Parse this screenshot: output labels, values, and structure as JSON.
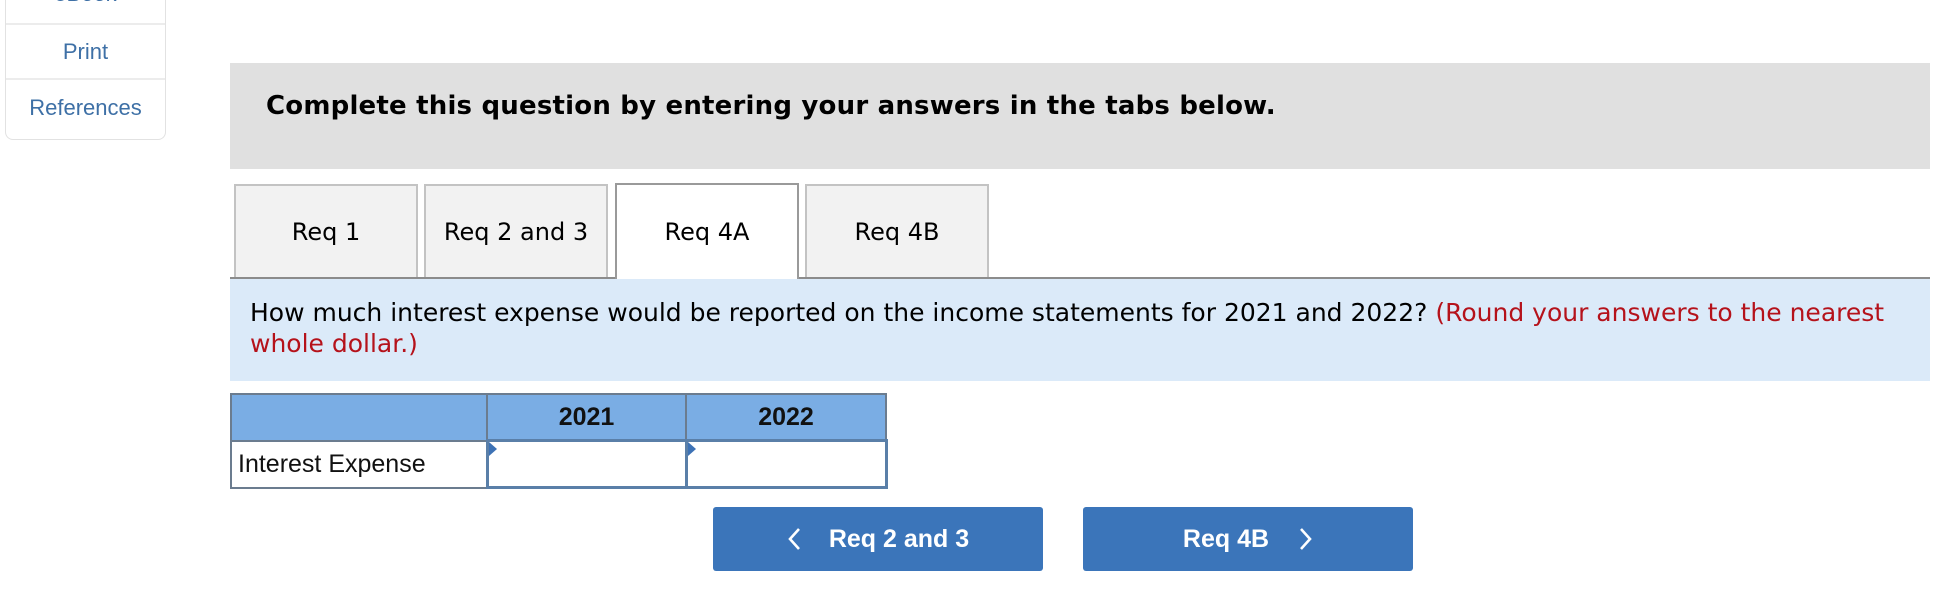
{
  "sidebar": {
    "items": [
      {
        "label": "eBook",
        "icon": "book"
      },
      {
        "label": "Print",
        "icon": "print"
      },
      {
        "label": "References",
        "icon": "references"
      }
    ]
  },
  "header": {
    "instruction": "Complete this question by entering your answers in the tabs below."
  },
  "tabs": [
    {
      "label": "Req 1",
      "active": false
    },
    {
      "label": "Req 2 and 3",
      "active": false
    },
    {
      "label": "Req 4A",
      "active": true
    },
    {
      "label": "Req 4B",
      "active": false
    }
  ],
  "prompt": {
    "question": "How much interest expense would be reported on the income statements for 2021 and 2022?",
    "note": "(Round your answers to the nearest whole dollar.)"
  },
  "table": {
    "columns": [
      "",
      "2021",
      "2022"
    ],
    "rows": [
      {
        "label": "Interest Expense",
        "values": [
          "",
          ""
        ]
      }
    ]
  },
  "navigation": {
    "prev_label": "Req 2 and 3",
    "next_label": "Req 4B"
  },
  "colors": {
    "accent_blue": "#3b75ba",
    "header_blue": "#7aade4",
    "prompt_bg": "#dbeaf9",
    "note_red": "#b5121b",
    "link_blue": "#3e70a6"
  }
}
